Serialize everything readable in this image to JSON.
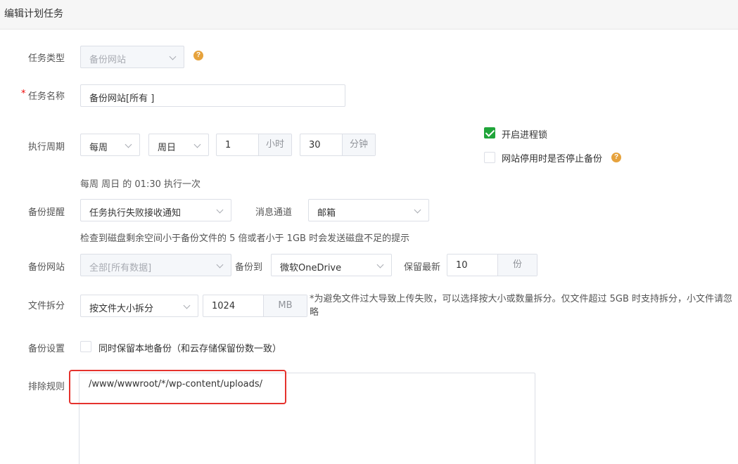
{
  "dialog": {
    "title": "编辑计划任务"
  },
  "task_type": {
    "label": "任务类型",
    "value": "备份网站"
  },
  "task_name": {
    "required_mark": "*",
    "label": "任务名称",
    "value": "备份网站[所有 ]"
  },
  "schedule": {
    "label": "执行周期",
    "period": "每周",
    "weekday": "周日",
    "hour_value": "1",
    "hour_unit": "小时",
    "minute_value": "30",
    "minute_unit": "分钟",
    "summary": "每周 周日 的 01:30 执行一次"
  },
  "options": {
    "process_lock": {
      "label": "开启进程锁",
      "checked": true
    },
    "stop_backup_when_disabled": {
      "label": "网站停用时是否停止备份",
      "checked": false
    }
  },
  "alert": {
    "label": "备份提醒",
    "value": "任务执行失败接收通知",
    "channel_label": "消息通道",
    "channel_value": "邮箱",
    "hint": "检查到磁盘剩余空间小于备份文件的 5 倍或者小于 1GB 时会发送磁盘不足的提示"
  },
  "backup_site": {
    "label": "备份网站",
    "value": "全部[所有数据]",
    "to_label": "备份到",
    "to_value": "微软OneDrive",
    "keep_label": "保留最新",
    "keep_value": "10",
    "keep_unit": "份"
  },
  "split": {
    "label": "文件拆分",
    "mode": "按文件大小拆分",
    "size_value": "1024",
    "size_unit": "MB",
    "note": "*为避免文件过大导致上传失败，可以选择按大小或数量拆分。仅文件超过 5GB 时支持拆分，小文件请忽略"
  },
  "backup_settings": {
    "label": "备份设置",
    "keep_local_label": "同时保留本地备份（和云存储保留份数一致）",
    "checked": false
  },
  "exclude": {
    "label": "排除规则",
    "value": "/www/wwwroot/*/wp-content/uploads/"
  },
  "colors": {
    "accent_green": "#20a53a",
    "help_orange": "#e6a23c",
    "highlight_red": "#e5322d",
    "required_red": "#ef0808"
  }
}
